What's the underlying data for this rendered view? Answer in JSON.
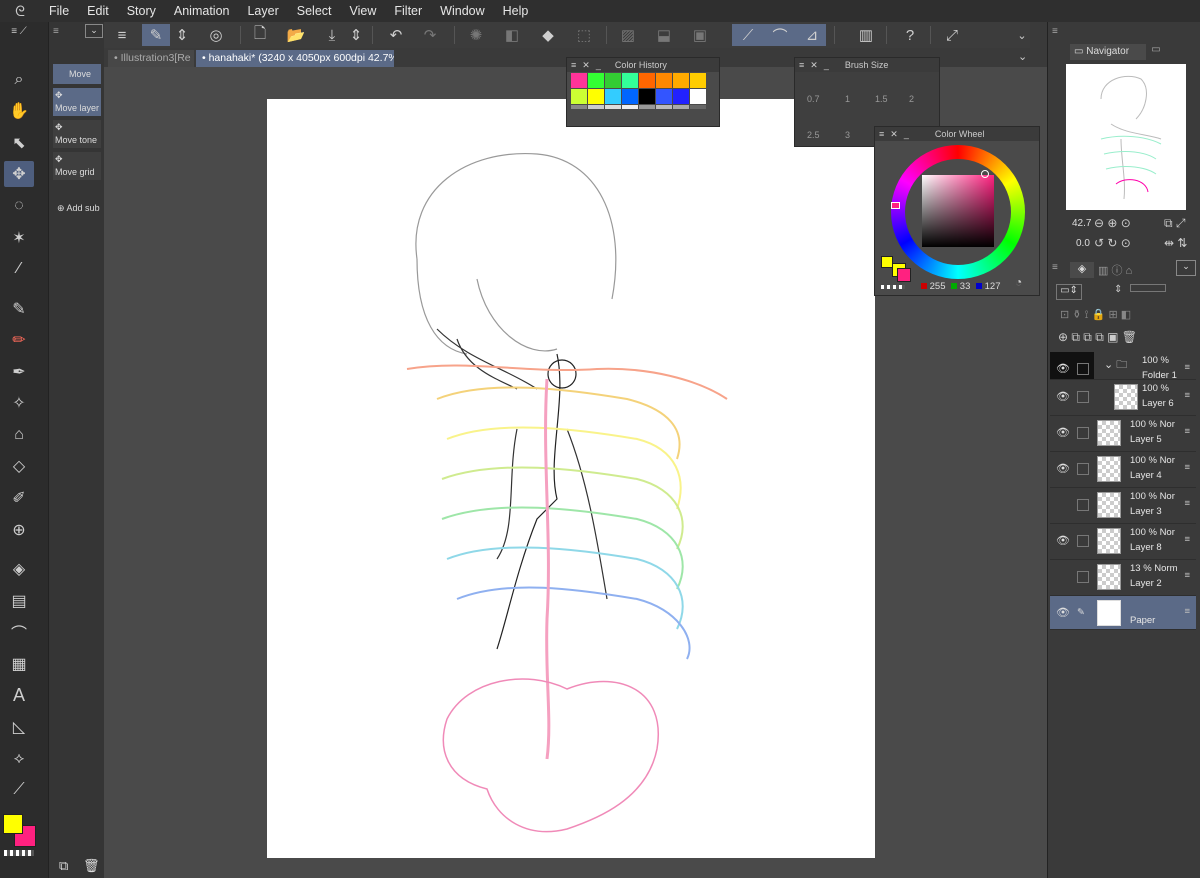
{
  "menu": {
    "items": [
      "File",
      "Edit",
      "Story",
      "Animation",
      "Layer",
      "Select",
      "View",
      "Filter",
      "Window",
      "Help"
    ]
  },
  "subtool": {
    "header": "Move",
    "items": [
      "Move layer",
      "Move tone",
      "Move grid"
    ],
    "add": "Add sub"
  },
  "tabs": {
    "inactive": "Illustration3[Re",
    "active": "hanahaki* (3240 x 4050px 600dpi 42.7%)"
  },
  "color_history": {
    "title": "Color History",
    "swatches": [
      "#ff3399",
      "#33ff33",
      "#33cc33",
      "#33ff99",
      "#ff6600",
      "#ff8800",
      "#ffaa00",
      "#ffcc00",
      "#ccff33",
      "#ffff00",
      "#33ccff",
      "#0066ff",
      "#000000",
      "#3355ff",
      "#2222ff",
      "#ffffff",
      "#888888",
      "#cccccc",
      "#dddddd",
      "#eeeeee",
      "#999999",
      "#bbbbbb",
      "#aaaaaa",
      "#666666"
    ]
  },
  "brush_size": {
    "title": "Brush Size",
    "values": [
      "0.7",
      "1",
      "1.5",
      "2",
      "2.5",
      "3"
    ]
  },
  "color_wheel": {
    "title": "Color Wheel",
    "r": "255",
    "g": "33",
    "b": "127",
    "main_color": "#ffff00",
    "sub_color": "#ff2180"
  },
  "navigator": {
    "title": "Navigator",
    "zoom": "42.7",
    "rotation": "0.0"
  },
  "layers": [
    {
      "pct": "100 %",
      "name": "Folder 1",
      "mode": "",
      "visible": true,
      "selected": false
    },
    {
      "pct": "100 %",
      "name": "Layer 6",
      "mode": "",
      "visible": true,
      "selected": false
    },
    {
      "pct": "100 %",
      "name": "Layer 5",
      "mode": "Nor",
      "visible": true,
      "selected": false
    },
    {
      "pct": "100 %",
      "name": "Layer 4",
      "mode": "Nor",
      "visible": true,
      "selected": false
    },
    {
      "pct": "100 %",
      "name": "Layer 3",
      "mode": "Nor",
      "visible": false,
      "selected": false
    },
    {
      "pct": "100 %",
      "name": "Layer 8",
      "mode": "Nor",
      "visible": true,
      "selected": false
    },
    {
      "pct": "13 %",
      "name": "Layer 2",
      "mode": "Norm",
      "visible": false,
      "selected": false
    },
    {
      "pct": "",
      "name": "Paper",
      "mode": "",
      "visible": true,
      "selected": true
    }
  ]
}
